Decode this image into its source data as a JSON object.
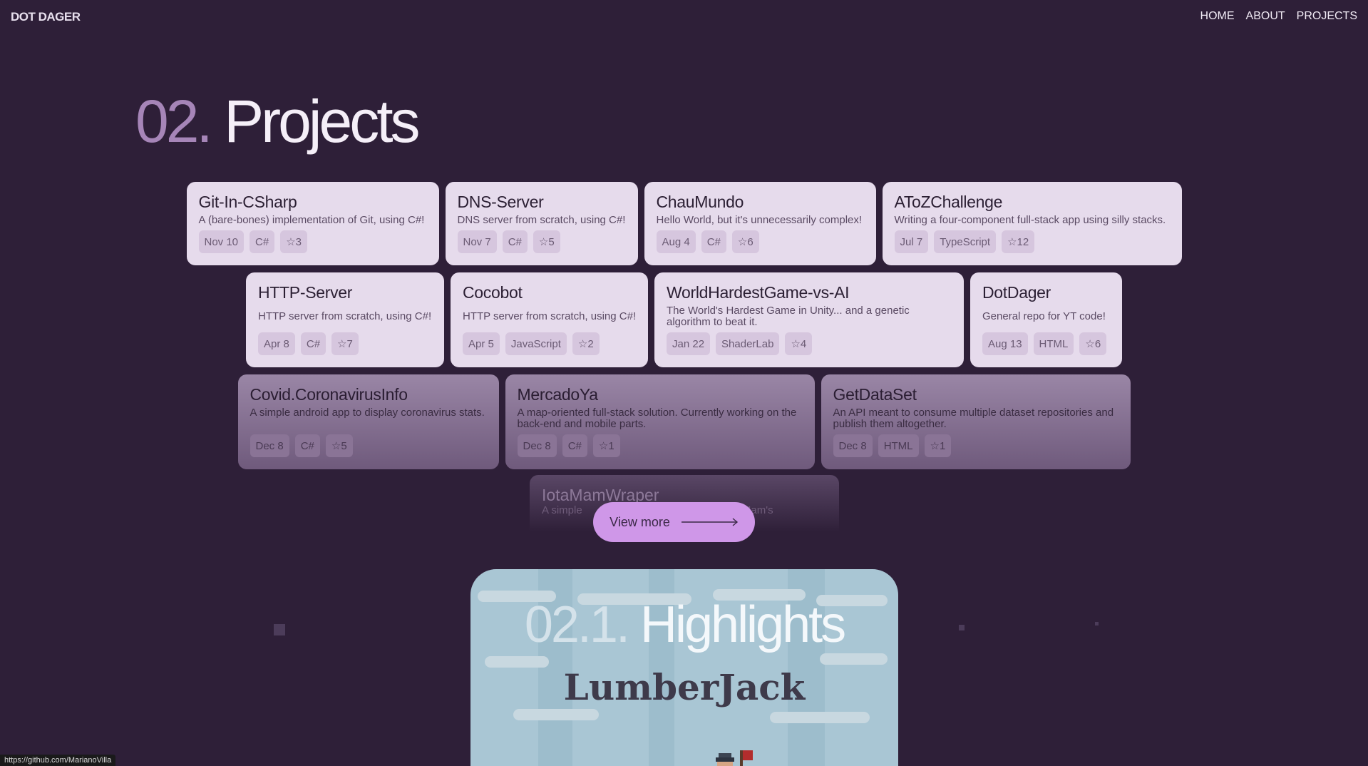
{
  "nav": {
    "logo": "DOT DAGER",
    "links": [
      "HOME",
      "ABOUT",
      "PROJECTS"
    ]
  },
  "section": {
    "number": "02.",
    "title": "Projects"
  },
  "projects": [
    {
      "name": "Git-In-CSharp",
      "description": "A (bare-bones) implementation of Git, using C#!",
      "date": "Nov 10",
      "language": "C#",
      "stars": "3"
    },
    {
      "name": "DNS-Server",
      "description": "DNS server from scratch, using C#!",
      "date": "Nov 7",
      "language": "C#",
      "stars": "5"
    },
    {
      "name": "ChauMundo",
      "description": "Hello World, but it's unnecessarily complex!",
      "date": "Aug 4",
      "language": "C#",
      "stars": "6"
    },
    {
      "name": "AToZChallenge",
      "description": "Writing a four-component full-stack app using silly stacks.",
      "date": "Jul 7",
      "language": "TypeScript",
      "stars": "12"
    },
    {
      "name": "HTTP-Server",
      "description": "HTTP server from scratch, using C#!",
      "date": "Apr 8",
      "language": "C#",
      "stars": "7"
    },
    {
      "name": "Cocobot",
      "description": "HTTP server from scratch, using C#!",
      "date": "Apr 5",
      "language": "JavaScript",
      "stars": "2"
    },
    {
      "name": "WorldHardestGame-vs-AI",
      "description": "The World's Hardest Game in Unity... and a genetic algorithm to beat it.",
      "date": "Jan 22",
      "language": "ShaderLab",
      "stars": "4"
    },
    {
      "name": "DotDager",
      "description": "General repo for YT code!",
      "date": "Aug 13",
      "language": "HTML",
      "stars": "6"
    },
    {
      "name": "Covid.CoronavirusInfo",
      "description": "A simple android app to display coronavirus stats.",
      "date": "Dec 8",
      "language": "C#",
      "stars": "5"
    },
    {
      "name": "MercadoYa",
      "description": "A map-oriented full-stack solution. Currently working on the back-end and mobile parts.",
      "date": "Dec 8",
      "language": "C#",
      "stars": "1"
    },
    {
      "name": "GetDataSet",
      "description": "An API meant to consume multiple dataset repositories and publish them altogether.",
      "date": "Dec 8",
      "language": "HTML",
      "stars": "1"
    },
    {
      "name": "IotaMamWraper",
      "description": "A simple",
      "description_tail": "Mam's"
    }
  ],
  "view_more": "View more",
  "highlights": {
    "number": "02.1.",
    "title": "Highlights",
    "game": "LumberJack"
  },
  "status_url": "https://github.com/MarianoVilla",
  "colors": {
    "background": "#2e1f38",
    "card": "#e6dbec",
    "accent": "#cf97e8"
  },
  "icons": {
    "star": "star-icon",
    "arrow": "arrow-right-icon"
  }
}
